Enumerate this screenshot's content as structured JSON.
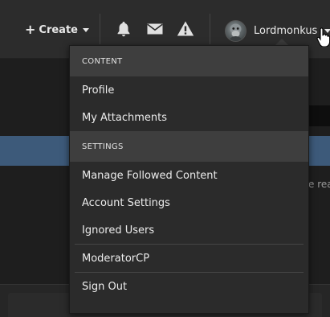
{
  "header": {
    "create_label": "Create",
    "username": "Lordmonkus",
    "icons": [
      "bell-icon",
      "envelope-icon",
      "warning-icon"
    ]
  },
  "background": {
    "partial_text": "e reac"
  },
  "menu": {
    "content_heading": "CONTENT",
    "content_items": [
      "Profile",
      "My Attachments"
    ],
    "settings_heading": "SETTINGS",
    "settings_items": [
      "Manage Followed Content",
      "Account Settings",
      "Ignored Users"
    ],
    "moderator_item": "ModeratorCP",
    "signout_item": "Sign Out"
  },
  "colors": {
    "topbar": "#2c2c2c",
    "menu_bg": "#2b2b2b",
    "menu_header_bg": "#3e3e3e",
    "accent_blue": "#3d5a7a"
  }
}
